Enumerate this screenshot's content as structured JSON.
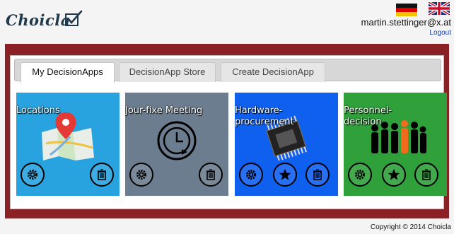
{
  "header": {
    "logo_text": "Choicla",
    "user_email": "martin.stettinger@x.at",
    "logout_label": "Logout",
    "languages": [
      "de-flag-icon",
      "uk-flag-icon"
    ]
  },
  "tabs": [
    {
      "label": "My DecisionApps",
      "active": true
    },
    {
      "label": "DecisionApp Store",
      "active": false
    },
    {
      "label": "Create DecisionApp",
      "active": false
    }
  ],
  "tiles": [
    {
      "title": "Locations",
      "color": "#29a3df",
      "icon": "map-pin-icon",
      "actions": [
        "gear-icon",
        "trash-icon"
      ]
    },
    {
      "title": "Jour-fixe Meeting",
      "color": "#6b7d8e",
      "icon": "clock-icon",
      "actions": [
        "gear-icon",
        "trash-icon"
      ]
    },
    {
      "title": "Hardware-procurement",
      "color": "#1060f0",
      "icon": "chip-icon",
      "actions": [
        "gear-icon",
        "star-icon",
        "trash-icon"
      ]
    },
    {
      "title": "Personnel-decision",
      "color": "#2fa03a",
      "icon": "people-icon",
      "actions": [
        "gear-icon",
        "star-icon",
        "trash-icon"
      ]
    }
  ],
  "footer": {
    "copyright": "Copyright © 2014 Choicla"
  },
  "colors": {
    "band": "#8a2125",
    "background": "#f4f4f4"
  }
}
